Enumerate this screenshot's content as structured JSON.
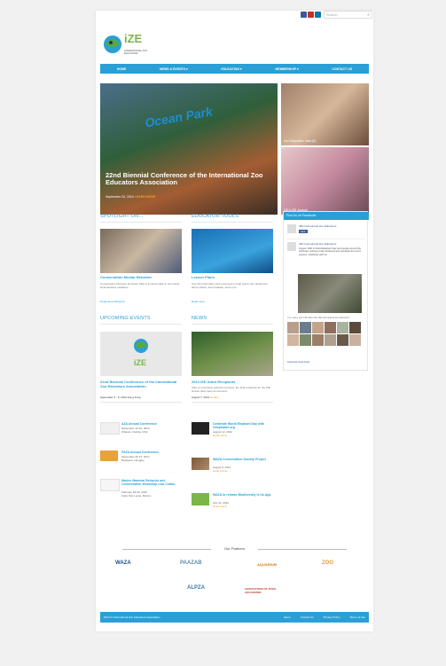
{
  "header": {
    "search_placeholder": "Search",
    "social_icons": [
      "facebook-icon",
      "twitter-icon",
      "linkedin-icon"
    ],
    "logo_text": "iZE",
    "logo_subtext": "INTERNATIONAL ZOO EDUCATORS"
  },
  "nav": {
    "items": [
      {
        "label": "Home"
      },
      {
        "label": "News & Events ▾"
      },
      {
        "label": "Education ▾"
      },
      {
        "label": "Membership ▾"
      },
      {
        "label": "Contact Us"
      }
    ]
  },
  "hero": {
    "sign_text": "Ocean Park",
    "title": "22nd Biennial Conference of the International Zoo Educators Association",
    "date": "September 24, 2014",
    "learn_more": "LEARN MORE"
  },
  "side_slides": [
    {
      "caption": "Zoo Educators Jobs (3)"
    },
    {
      "caption": "2014 IZE Journal"
    }
  ],
  "spotlight": {
    "title": "Spotlight On...",
    "item_title": "Conservation Moolar Behavior",
    "item_text": "Conservation Monitors at Ocean Park is involved daily in promoting local behavior initiatives",
    "more": "Read about Behavior"
  },
  "educator_tools": {
    "title": "Educator Tools",
    "item_title": "Lesson Plans",
    "item_text": "Use this information and resources to help teach your audiences about sharks, their habitats, and more.",
    "more": "Read more"
  },
  "facebook": {
    "title": "Find Us on Facebook",
    "page_name": "IZE International Zoo Educators",
    "like_label": "Like",
    "post_name": "IZE International Zoo Educators",
    "post_text": "August: 30th is World Elephant Day and people around the world are uniting to help elephants and celebrate the iconic species. Celebrate with us!",
    "people_like": "You, Jenny and 148 others like IZE International Zoo Educators",
    "plugin": "Facebook social plugin"
  },
  "upcoming": {
    "title": "Upcoming Events",
    "feature_logo": "iZE",
    "feature_title": "22nd Biennial Conference of the International Zoo Educators Association",
    "feature_date": "September 2 - 6, 2014 Hong Kong",
    "events": [
      {
        "title": "AZA Annual Conference",
        "date": "September 12-16, 2014",
        "place": "Orlando, Florida, USA"
      },
      {
        "title": "PAZA Annual Conference",
        "date": "September 20-27, 2014",
        "place": "Budapest, Hungary"
      },
      {
        "title": "Marine Mammal Behavior and Conservation Workshop Lisa Colton",
        "date": "February 18-20, 2015",
        "place": "Cabo San Lucas, Mexico"
      }
    ]
  },
  "news": {
    "title": "News",
    "feature_title": "2014 IZE Grant Recipients",
    "feature_text": "After an extensive selection process, the final recipients for the IZE Grants have been announced.",
    "feature_date": "August 7, 2014",
    "feature_more": "Details",
    "items": [
      {
        "title": "Celebrate World Elephant Day with #elephants org",
        "date": "August 12, 2014",
        "more": "Read Article"
      },
      {
        "title": "WAZA Conservation Society Project",
        "date": "August 8, 2014",
        "more": "Read Article"
      },
      {
        "title": "WAZA to release Biodiversity is Us App",
        "date": "July 31, 2014",
        "more": "Read Article"
      }
    ]
  },
  "partners": {
    "title": "Our Partners",
    "logos": [
      "WAZA",
      "PAAZAB",
      "AQUARIUM",
      "ZOO",
      "ALPZA",
      "ASSOCIATION OF ZOOS AQUARIUMS"
    ]
  },
  "footer": {
    "copyright": "2014 © International Zoo Educators Association",
    "links": [
      "Home",
      "Contact Us",
      "Privacy Policy",
      "Terms of Use"
    ]
  },
  "colors": {
    "brand_blue": "#2a9fd6",
    "accent_orange": "#f0a030"
  }
}
